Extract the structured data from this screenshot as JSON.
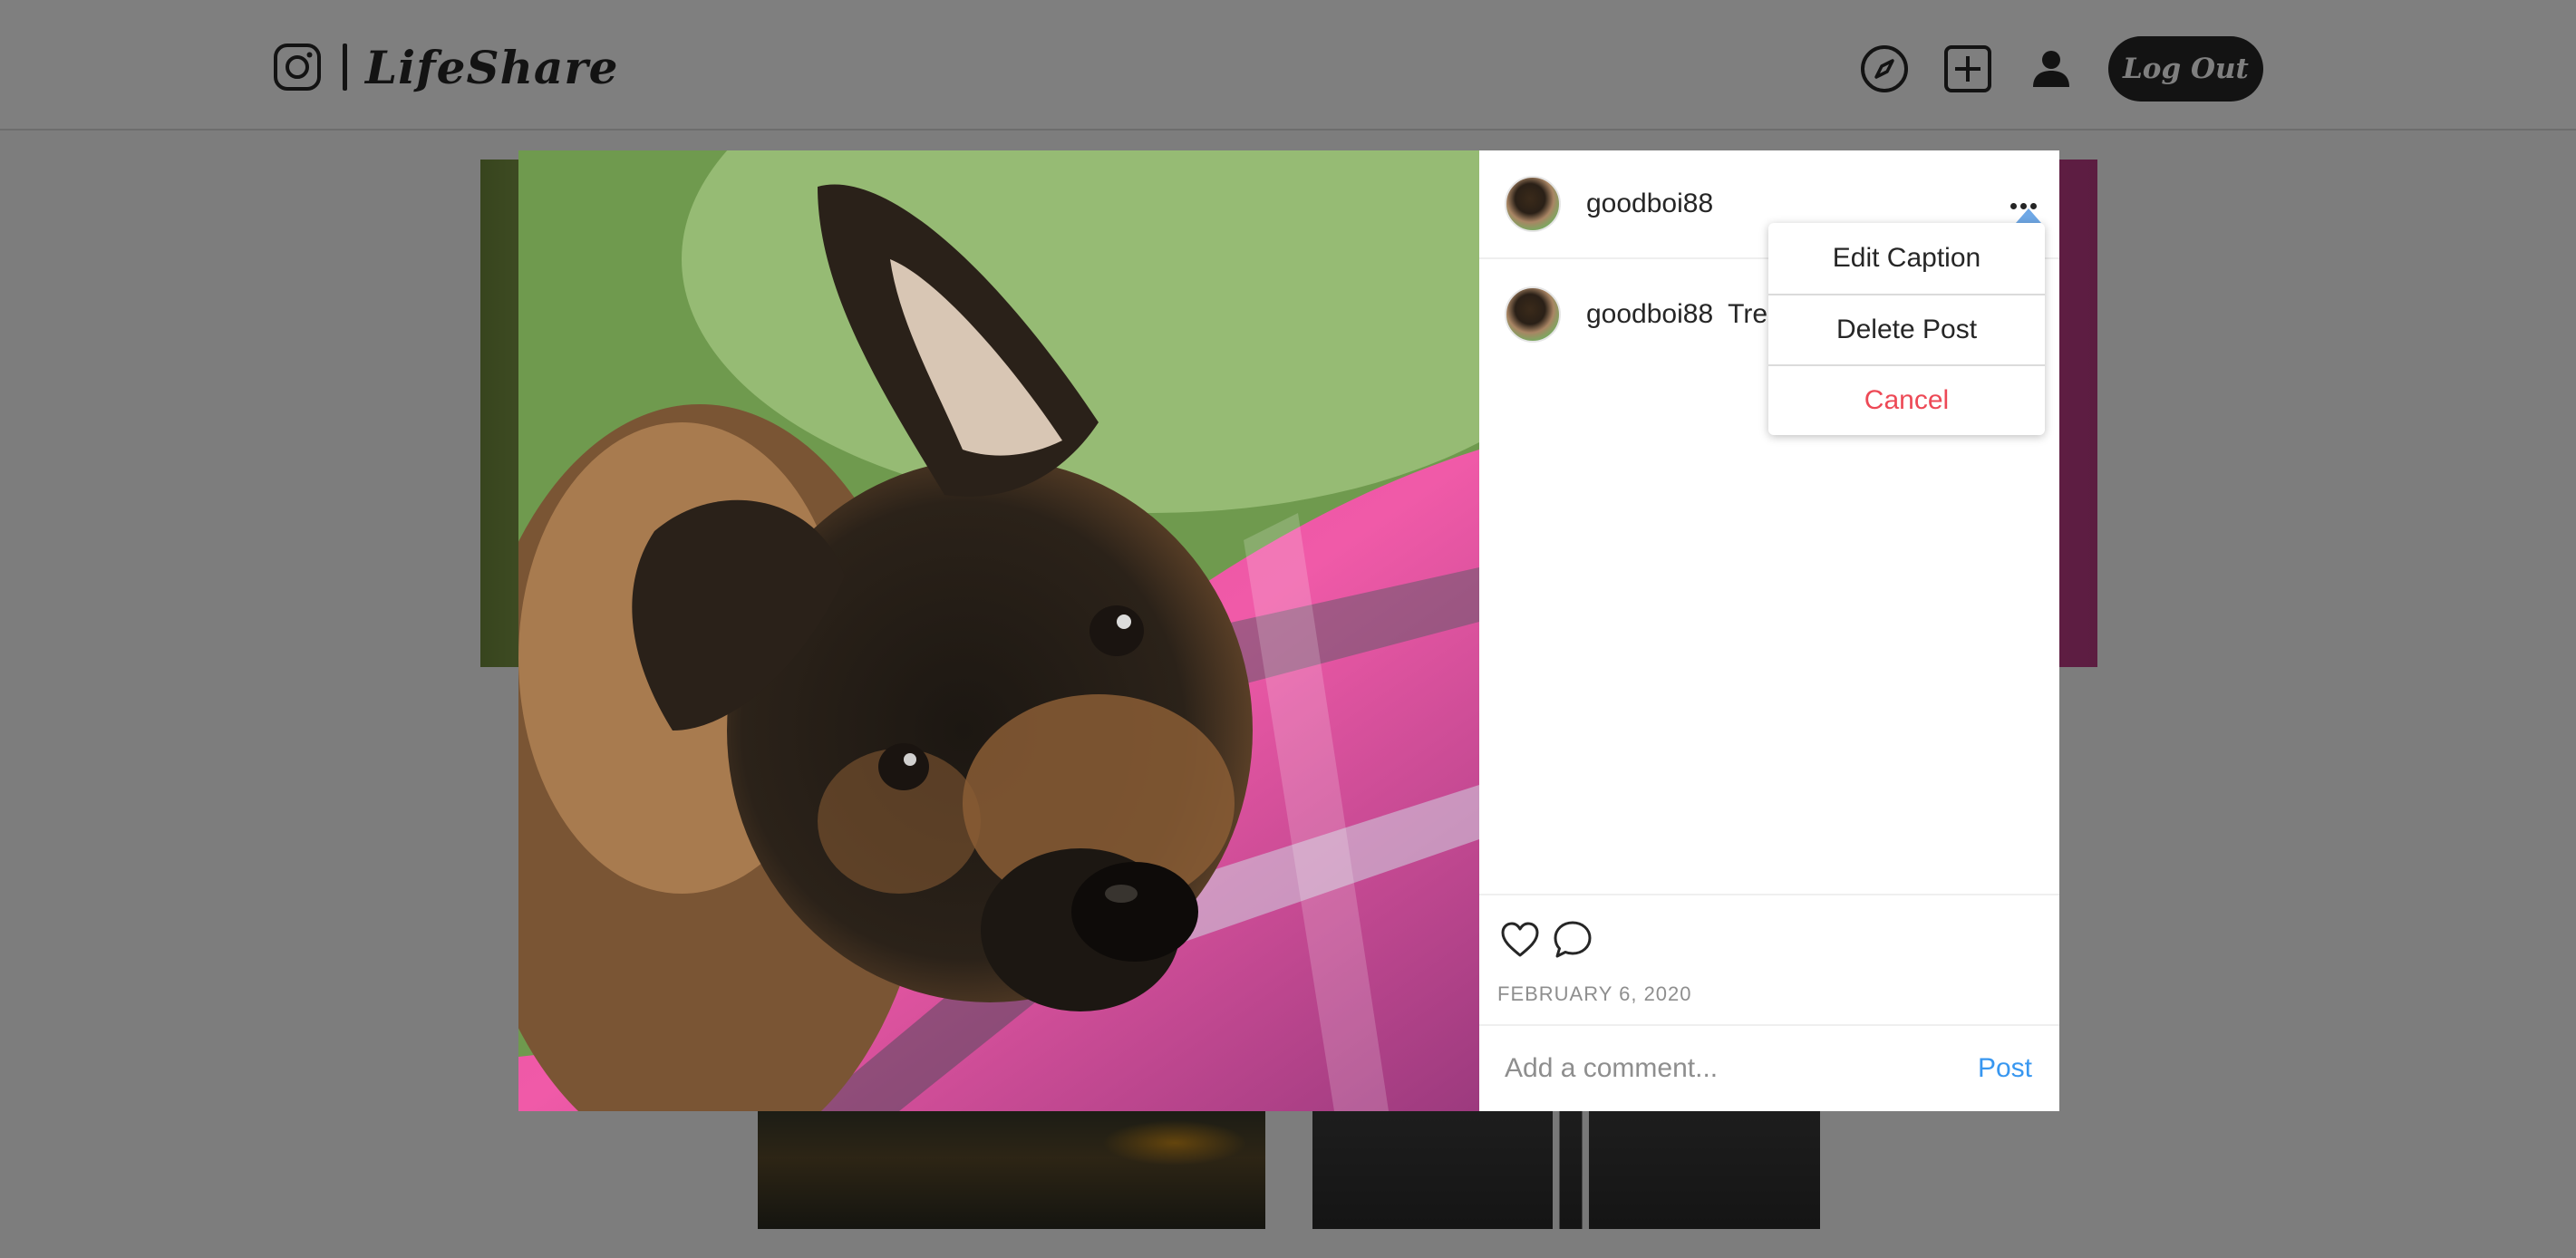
{
  "app": {
    "brand_name": "LifeShare"
  },
  "nav": {
    "logout_label": "Log Out",
    "icons": [
      "instagram-logo-icon",
      "compass-icon",
      "plus-square-icon",
      "user-icon"
    ]
  },
  "post": {
    "username": "goodboi88",
    "caption_prefix": "Tre",
    "date": "FEBRUARY 6, 2020"
  },
  "menu": {
    "edit_caption": "Edit Caption",
    "delete_post": "Delete Post",
    "cancel": "Cancel"
  },
  "comment": {
    "placeholder": "Add a comment...",
    "post_label": "Post"
  },
  "colors": {
    "accent_blue": "#3897f0",
    "danger_red": "#ed4956",
    "text_primary": "#262626",
    "text_muted": "#8e8e8e"
  }
}
